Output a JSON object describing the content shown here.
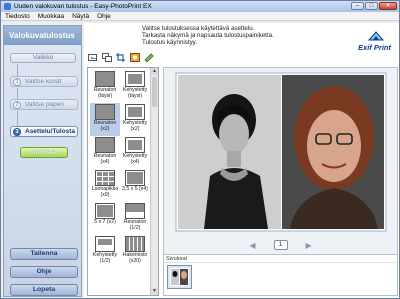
{
  "window": {
    "title": "Uuden valokuvan tulostus - Easy-PhotoPrint EX",
    "controls": {
      "minimize": "–",
      "maximize": "□",
      "close": "✕"
    }
  },
  "menu": [
    "Tiedosto",
    "Muokkaa",
    "Näytä",
    "Ohje"
  ],
  "sidebar": {
    "title": "Valokuvatulostus",
    "top_button": "Valikko",
    "steps": [
      {
        "num": "1",
        "label": "Valitse kuvat"
      },
      {
        "num": "2",
        "label": "Valitse paperi"
      },
      {
        "num": "3",
        "label": "Asettelu/Tulosta"
      }
    ],
    "print_button": "Tulosta",
    "bottom_buttons": [
      "Tallenna",
      "Ohje",
      "Lopeta"
    ]
  },
  "main": {
    "instructions": [
      "Valitse tulostuksessa käytettävä asettelu.",
      "Tarkasta näkymä ja napsauta tulostuspainiketta.",
      "Tulostus käynnistyy."
    ],
    "logo_text": "Exif Print",
    "colors": {
      "accent": "#3f6fb6",
      "selected": "#b9cde9",
      "green": "#a4d65c"
    },
    "toolbar_icons": [
      "image-edit-icon",
      "crop-copy-icon",
      "crop-icon",
      "correct-icon",
      "settings-icon"
    ],
    "layouts": [
      {
        "label": "Reunaton\n(täysi)"
      },
      {
        "label": "Kehystetty\n(täysi)"
      },
      {
        "label": "Reunaton\n(x2)",
        "selected": true
      },
      {
        "label": "Kehystetty\n(x2)"
      },
      {
        "label": "Reunaton\n(x4)"
      },
      {
        "label": "Kehystetty\n(x4)"
      },
      {
        "label": "Luonapikko (x9)"
      },
      {
        "label": "3,5 x 5 (x4)"
      },
      {
        "label": "5 x 7 (x2)"
      },
      {
        "label": "Reunaton\n(1/2)"
      },
      {
        "label": "Kehystetty\n(1/2)"
      },
      {
        "label": "Hakemisto\n(x20)"
      }
    ],
    "page_number": "1",
    "tray_label": "Sivukirat"
  }
}
